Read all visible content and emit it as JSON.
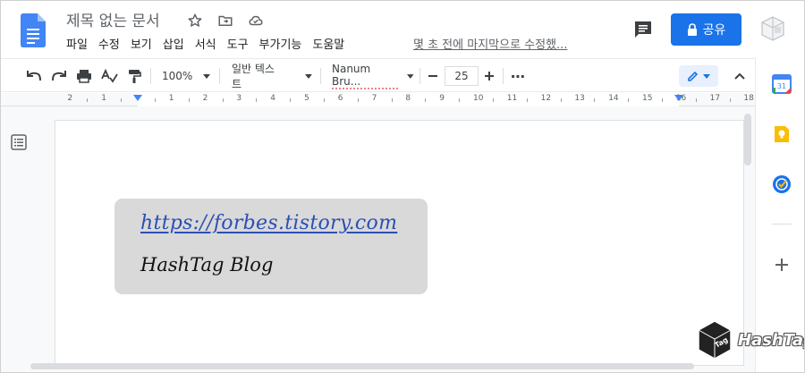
{
  "header": {
    "title": "제목 없는 문서",
    "menu": [
      "파일",
      "수정",
      "보기",
      "삽입",
      "서식",
      "도구",
      "부가기능",
      "도움말"
    ],
    "last_edit": "몇 초 전에 마지막으로 수정했...",
    "share_label": "공유"
  },
  "toolbar": {
    "zoom": "100%",
    "style": "일반 텍스트",
    "font": "Nanum Bru...",
    "font_size": "25",
    "more": "⋯"
  },
  "ruler": {
    "labels": [
      "2",
      "1",
      "1",
      "2",
      "3",
      "4",
      "5",
      "6",
      "7",
      "8",
      "9",
      "10",
      "11",
      "12",
      "13",
      "14",
      "15",
      "16",
      "17",
      "18"
    ]
  },
  "document": {
    "link_text": "https://forbes.tistory.com",
    "blog_text": "HashTag Blog"
  },
  "watermark": {
    "text": "HashTag"
  },
  "colors": {
    "accent": "#1a73e8",
    "docs_blue": "#4285f4",
    "link": "#2b4fb3",
    "card_bg": "#d9d9d9"
  }
}
